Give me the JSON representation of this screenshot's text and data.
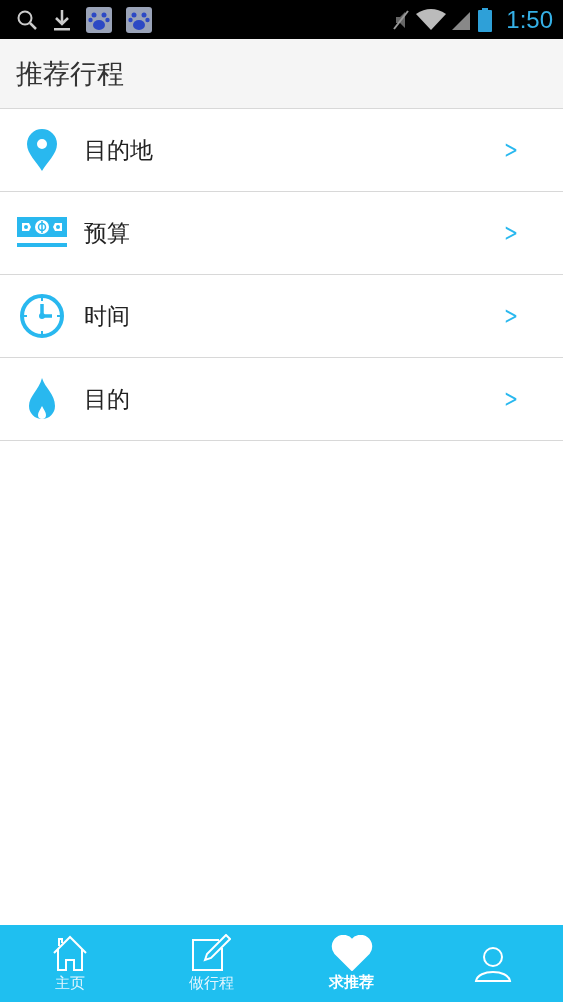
{
  "status_bar": {
    "time": "1:50"
  },
  "header": {
    "title": "推荐行程"
  },
  "items": [
    {
      "kind": "pin",
      "label": "目的地",
      "chevron": ">"
    },
    {
      "kind": "money",
      "label": "预算",
      "chevron": ">"
    },
    {
      "kind": "clock",
      "label": "时间",
      "chevron": ">"
    },
    {
      "kind": "flame",
      "label": "目的",
      "chevron": ">"
    }
  ],
  "tabs": [
    {
      "kind": "home",
      "label": "主页",
      "selected": false
    },
    {
      "kind": "edit",
      "label": "做行程",
      "selected": false
    },
    {
      "kind": "heart",
      "label": "求推荐",
      "selected": true
    },
    {
      "kind": "user",
      "selected": false
    }
  ]
}
